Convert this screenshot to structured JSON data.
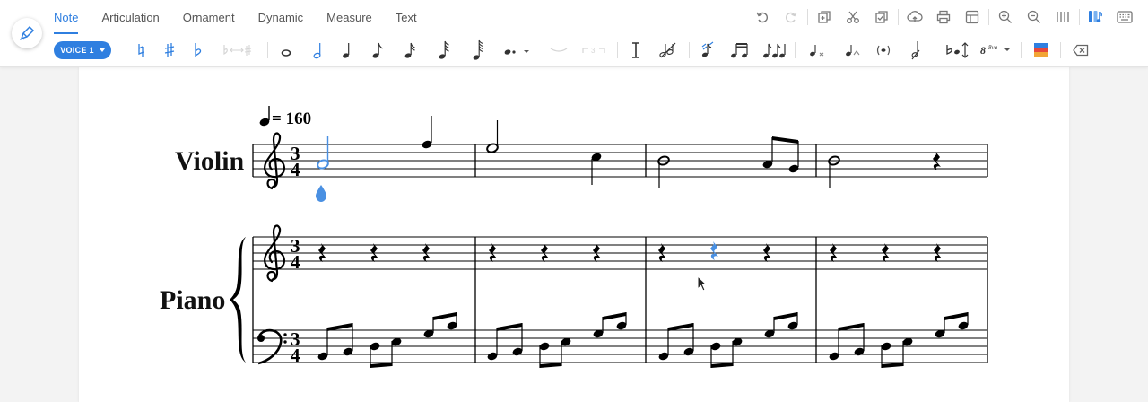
{
  "tabs": [
    {
      "label": "Note",
      "active": true
    },
    {
      "label": "Articulation",
      "active": false
    },
    {
      "label": "Ornament",
      "active": false
    },
    {
      "label": "Dynamic",
      "active": false
    },
    {
      "label": "Measure",
      "active": false
    },
    {
      "label": "Text",
      "active": false
    }
  ],
  "voice_button": {
    "label": "VOICE 1"
  },
  "score": {
    "tempo_mark": "= 160",
    "time_signature": {
      "top": "3",
      "bottom": "4"
    },
    "instruments": [
      {
        "name": "Violin"
      },
      {
        "name": "Piano"
      }
    ],
    "ottava_label": "8va"
  },
  "colors": {
    "accent": "#2f7fe0",
    "selection": "#4a90e2"
  },
  "icons": {
    "right_toolbar": [
      "undo-icon",
      "redo-icon",
      "copy-icon",
      "cut-icon",
      "paste-icon",
      "upload-icon",
      "print-icon",
      "layout-icon",
      "zoom-in-icon",
      "zoom-out-icon",
      "barlines-icon",
      "mixer-icon",
      "keyboard-icon"
    ],
    "note_toolbar": [
      "natural-icon",
      "sharp-icon",
      "flat-icon",
      "enharmonic-icon",
      "whole-note-icon",
      "half-note-icon",
      "quarter-note-icon",
      "eighth-note-icon",
      "sixteenth-note-icon",
      "thirty-second-note-icon",
      "sixty-fourth-note-icon",
      "dot-icon",
      "tie-icon",
      "tuplet-icon",
      "cursor-line-icon",
      "delete-note-icon",
      "grace-note-icon",
      "beam-icon",
      "unbeam-icon",
      "acciaccatura-icon",
      "appoggiatura-icon",
      "parenthesis-icon",
      "cross-staff-icon",
      "flip-stem-icon",
      "ottava-icon",
      "color-icon",
      "backspace-icon"
    ]
  }
}
